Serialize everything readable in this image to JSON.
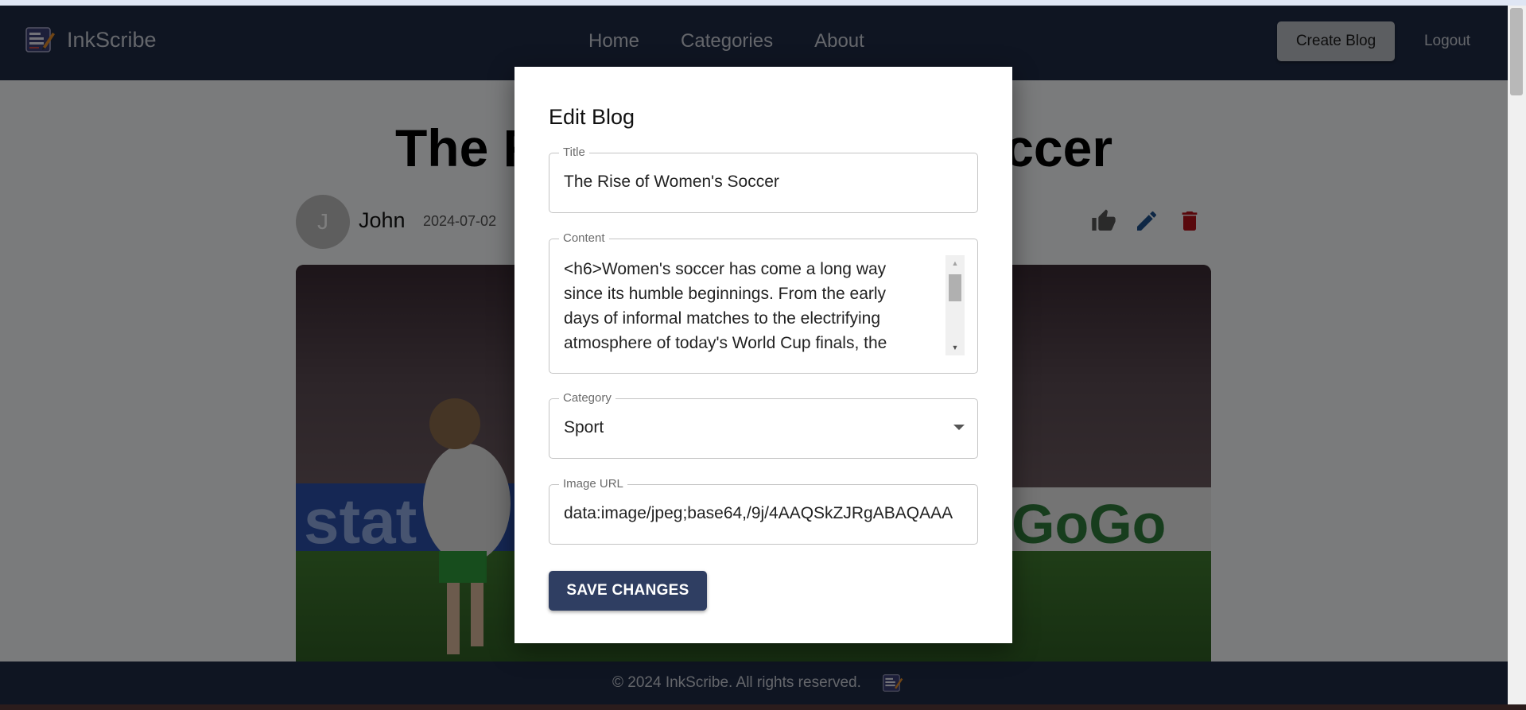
{
  "colors": {
    "navbar": "#1e2a44",
    "footer": "#1e2a44",
    "primary_button": "#2f3e62",
    "like_icon": "#555555",
    "edit_icon": "#1c4f8a",
    "delete_icon": "#b3121a"
  },
  "navbar": {
    "brand": "InkScribe",
    "links": [
      "Home",
      "Categories",
      "About"
    ],
    "create_button": "Create Blog",
    "logout_button": "Logout"
  },
  "article": {
    "title": "The Rise of Women's Soccer",
    "author_initial": "J",
    "author": "John",
    "date": "2024-07-02",
    "icons": [
      "thumb-up-icon",
      "pencil-icon",
      "trash-icon"
    ]
  },
  "modal": {
    "heading": "Edit Blog",
    "title_field": {
      "label": "Title",
      "value": "The Rise of Women's Soccer"
    },
    "content_field": {
      "label": "Content",
      "value": "<h6>Women's soccer has come a long way since its humble beginnings. From the early days of informal matches to the electrifying atmosphere of today's World Cup finals, the"
    },
    "category_field": {
      "label": "Category",
      "value": "Sport"
    },
    "image_field": {
      "label": "Image URL",
      "value": "data:image/jpeg;base64,/9j/4AAQSkZJRgABAQAAA"
    },
    "save_button": "SAVE CHANGES"
  },
  "footer": {
    "text": "© 2024 InkScribe. All rights reserved."
  }
}
